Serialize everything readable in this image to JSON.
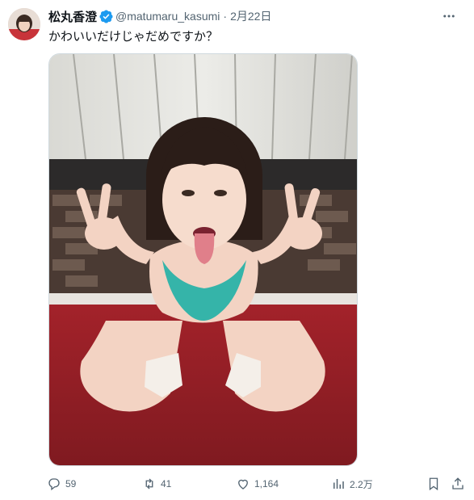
{
  "author": {
    "display_name": "松丸香澄",
    "handle": "@matumaru_kasumi",
    "separator": "·",
    "date": "2月22日",
    "verified": true
  },
  "tweet": {
    "text": "かわいいだけじゃだめですか？"
  },
  "actions": {
    "reply_count": "59",
    "repost_count": "41",
    "like_count": "1,164",
    "view_count": "2.2万"
  },
  "icons": {
    "verified": "verified-badge-icon",
    "more": "more-options-icon",
    "reply": "reply-icon",
    "repost": "repost-icon",
    "like": "like-icon",
    "views": "views-icon",
    "bookmark": "bookmark-icon",
    "share": "share-icon"
  },
  "colors": {
    "text_primary": "#0f1419",
    "text_secondary": "#536471",
    "verified_blue": "#1d9bf0",
    "border": "#cfd9de"
  }
}
